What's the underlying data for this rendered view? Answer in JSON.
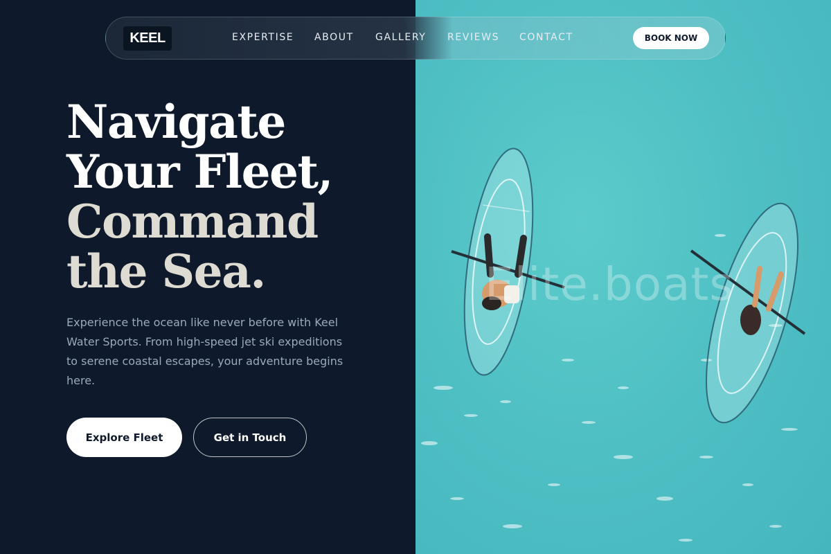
{
  "brand": {
    "logo_text": "KEEL"
  },
  "nav": {
    "links": [
      "EXPERTISE",
      "ABOUT",
      "GALLERY",
      "REVIEWS",
      "CONTACT"
    ],
    "cta_label": "BOOK NOW"
  },
  "hero": {
    "headline_lines": [
      "Navigate",
      "Your Fleet,",
      "Command",
      "the Sea."
    ],
    "description": "Experience the ocean like never before with Keel Water Sports. From high-speed jet ski expeditions to serene coastal escapes, your adventure begins here.",
    "primary_button": "Explore Fleet",
    "secondary_button": "Get in Touch"
  },
  "image": {
    "watermark_text": "Elite.boats",
    "alt": "Aerial view of two people paddling transparent kayaks on turquoise water"
  },
  "colors": {
    "background": "#0e1a2b",
    "water": "#4fc0c4",
    "accent_text": "#ffffff",
    "muted_text": "#9aa9bd"
  }
}
